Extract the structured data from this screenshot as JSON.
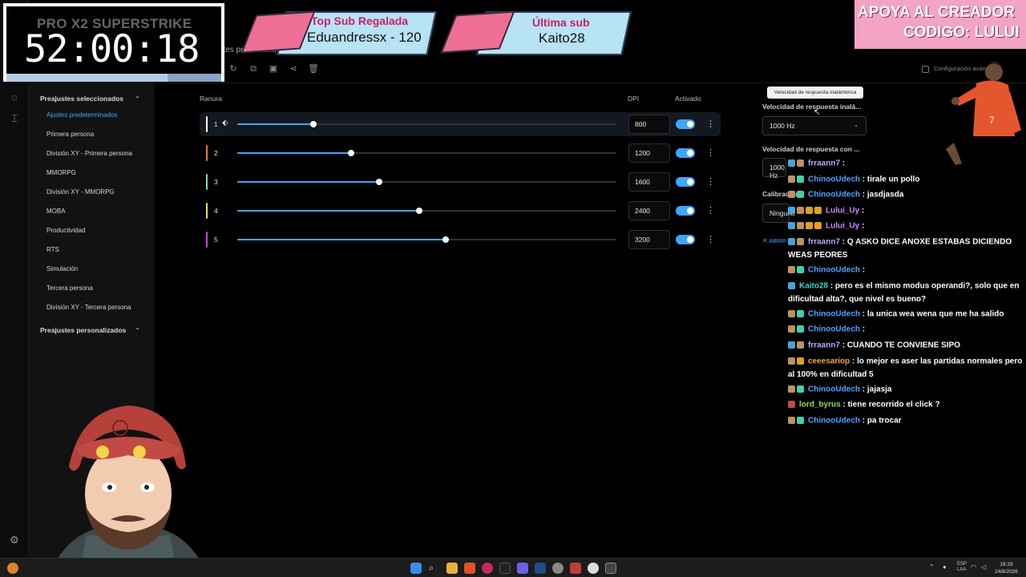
{
  "app": {
    "title": "Ajustes predeterminados",
    "advanced_label": "Configuración avanzada"
  },
  "sidebar": {
    "group1_label": "Preajustes seleccionados",
    "items": [
      {
        "label": "Ajustes predeterminados",
        "active": true
      },
      {
        "label": "Primera persona"
      },
      {
        "label": "División XY - Primera persona"
      },
      {
        "label": "MMORPG"
      },
      {
        "label": "División XY - MMORPG"
      },
      {
        "label": "MOBA"
      },
      {
        "label": "Productividad"
      },
      {
        "label": "RTS"
      },
      {
        "label": "Simulación"
      },
      {
        "label": "Tercera persona"
      },
      {
        "label": "División XY - Tercera persona"
      }
    ],
    "group2_label": "Preajustes personalizados"
  },
  "dpi_table": {
    "col_slot": "Ranura",
    "col_dpi": "DPI",
    "col_enabled": "Activado",
    "rows": [
      {
        "slot": "1",
        "dpi": "800",
        "level": 0.2,
        "color": "#ffffff"
      },
      {
        "slot": "2",
        "dpi": "1200",
        "level": 0.3,
        "color": "#f07a3a"
      },
      {
        "slot": "3",
        "dpi": "1600",
        "level": 0.375,
        "color": "#6fe0a6"
      },
      {
        "slot": "4",
        "dpi": "2400",
        "level": 0.48,
        "color": "#f2e14a"
      },
      {
        "slot": "5",
        "dpi": "3200",
        "level": 0.55,
        "color": "#d23fd2"
      }
    ]
  },
  "right_panel": {
    "tooltip": "Velocidad de respuesta inalámbrica",
    "wireless_label": "Velocidad de respuesta inalá...",
    "wireless_value": "1000 Hz",
    "wired_label": "Velocidad de respuesta con ...",
    "wired_value": "1000 Hz",
    "calib_label": "Calibración",
    "calib_value": "Ninguna",
    "link_label": "ABRIR"
  },
  "overlay": {
    "timer_title": "PRO X2 SUPERSTRIKE",
    "timer_value": "52:00:18",
    "top_sub_title": "Top Sub Regalada",
    "top_sub_value": "Eduandressx - 120",
    "last_sub_title": "Última sub",
    "last_sub_value": "Kaito28",
    "support_line1": "APOYA AL CREADOR",
    "support_line2": "CODIGO: LULUI"
  },
  "chat": [
    {
      "user": "frraann7",
      "text": "",
      "color": "#b9a7ff"
    },
    {
      "user": "ChinooUdech",
      "text": "tirale un pollo",
      "color": "#4fa3ff"
    },
    {
      "user": "ChinooUdech",
      "text": "jasdjasda",
      "color": "#4fa3ff"
    },
    {
      "user": "Lului_Uy",
      "text": "",
      "color": "#c98bff"
    },
    {
      "user": "Lului_Uy",
      "text": "",
      "color": "#c98bff"
    },
    {
      "user": "frraann7",
      "text": "Q ASKO DICE ANOXE ESTABAS DICIENDO WEAS PEORES",
      "color": "#b9a7ff"
    },
    {
      "user": "ChinooUdech",
      "text": "",
      "color": "#4fa3ff"
    },
    {
      "user": "Kaito28",
      "text": "pero es el mismo modus operandi?, solo que en dificultad alta?, que nivel es bueno?",
      "color": "#3ed0d0"
    },
    {
      "user": "ChinooUdech",
      "text": "la unica wea wena que me ha salido",
      "color": "#4fa3ff"
    },
    {
      "user": "ChinooUdech",
      "text": "",
      "color": "#4fa3ff"
    },
    {
      "user": "frraann7",
      "text": "CUANDO TE CONVIENE SIPO",
      "color": "#b9a7ff"
    },
    {
      "user": "ceeesariop",
      "text": "lo mejor es aser las partidas normales pero al 100% en dificultad 5",
      "color": "#f2a33a"
    },
    {
      "user": "ChinooUdech",
      "text": "jajasja",
      "color": "#4fa3ff"
    },
    {
      "user": "lord_byrus",
      "text": "tiene recorrido el click ?",
      "color": "#8ee04a"
    },
    {
      "user": "ChinooUdech",
      "text": "pa trocar",
      "color": "#4fa3ff"
    }
  ],
  "taskbar": {
    "lang": "ESP",
    "lang2": "LAA",
    "time": "19:29",
    "date": "24/8/2026"
  }
}
